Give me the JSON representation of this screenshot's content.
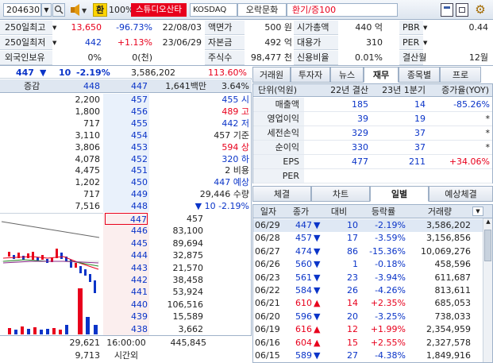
{
  "toolbar": {
    "code": "204630",
    "hwan": "환",
    "zoom": "100%",
    "broker_name": "스튜디오산타",
    "market": "KOSDAQ",
    "category": "오락문화",
    "note": "환기/증100"
  },
  "info_left": [
    {
      "label": "250일최고",
      "value": "13,650",
      "pct": "-96.73%",
      "date": "22/08/03",
      "color": "red",
      "pct_color": "blue"
    },
    {
      "label": "250일최저",
      "value": "442",
      "pct": "+1.13%",
      "date": "23/06/29",
      "color": "blue",
      "pct_color": "red"
    },
    {
      "label": "외국인보유",
      "value": "0%",
      "pct": "0(천)",
      "date": ""
    }
  ],
  "info_mid": [
    {
      "label": "액면가",
      "value": "500 원"
    },
    {
      "label": "자본금",
      "value": "492 억"
    },
    {
      "label": "주식수",
      "value": "98,477 천"
    }
  ],
  "info_right": [
    {
      "label": "시가총액",
      "value": "440 억",
      "label2": "PBR",
      "value2": "0.44"
    },
    {
      "label": "대용가",
      "value": "310",
      "label2": "PER",
      "value2": ""
    },
    {
      "label": "신용비율",
      "value": "0.01%",
      "label2": "결산월",
      "value2": "12월"
    }
  ],
  "quote": {
    "price": "447",
    "arrow": "▼",
    "change": "10",
    "pct": "-2.19%",
    "volume": "3,586,202",
    "vol_pct": "113.60%",
    "gamgam": "증감",
    "bid_price": "448",
    "ask_price": "447",
    "amount": "1,641백만",
    "ratio": "3.64%"
  },
  "ask_rows": [
    {
      "qty": "2,200",
      "price": "457",
      "label": "455 시",
      "lc": "blue"
    },
    {
      "qty": "1,800",
      "price": "456",
      "label": "489 고",
      "lc": "red"
    },
    {
      "qty": "717",
      "price": "455",
      "label": "442 저",
      "lc": "blue"
    },
    {
      "qty": "3,110",
      "price": "454",
      "label": "457 기준",
      "lc": ""
    },
    {
      "qty": "3,806",
      "price": "453",
      "label": "594 상",
      "lc": "red"
    },
    {
      "qty": "4,078",
      "price": "452",
      "label": "320 하",
      "lc": "blue"
    },
    {
      "qty": "4,475",
      "price": "451",
      "label": "2 비용",
      "lc": ""
    },
    {
      "qty": "1,202",
      "price": "450",
      "label": "447 예상",
      "lc": "blue"
    },
    {
      "qty": "717",
      "price": "449",
      "label": "29,446 수량",
      "lc": ""
    },
    {
      "qty": "7,516",
      "price": "448",
      "label": "▼ 10   -2.19%",
      "lc": "blue"
    }
  ],
  "bid_rows": [
    {
      "price": "447",
      "qty": "457"
    },
    {
      "price": "446",
      "qty": "83,100"
    },
    {
      "price": "445",
      "qty": "89,694"
    },
    {
      "price": "444",
      "qty": "32,875"
    },
    {
      "price": "443",
      "qty": "21,570"
    },
    {
      "price": "442",
      "qty": "38,458"
    },
    {
      "price": "441",
      "qty": "53,924"
    },
    {
      "price": "440",
      "qty": "106,516"
    },
    {
      "price": "439",
      "qty": "15,589"
    },
    {
      "price": "438",
      "qty": "3,662"
    }
  ],
  "totals": {
    "ask_total": "29,621",
    "ask_after": "9,713",
    "time": "16:00:00",
    "after_label": "시간외",
    "bid_total": "445,845"
  },
  "top_tabs": [
    "거래원",
    "투자자",
    "뉴스",
    "재무",
    "종목별",
    "프로"
  ],
  "fin": {
    "headers": [
      "단위(억원)",
      "22년 결산",
      "23년 1분기",
      "증가율(YOY)"
    ],
    "rows": [
      {
        "label": "매출액",
        "a": "185",
        "b": "14",
        "c": "-85.26%",
        "cc": "blue"
      },
      {
        "label": "영업이익",
        "a": "39",
        "b": "19",
        "c": "*",
        "cc": ""
      },
      {
        "label": "세전손익",
        "a": "329",
        "b": "37",
        "c": "*",
        "cc": ""
      },
      {
        "label": "순이익",
        "a": "330",
        "b": "37",
        "c": "*",
        "cc": ""
      },
      {
        "label": "EPS",
        "a": "477",
        "b": "211",
        "c": "+34.06%",
        "cc": "red"
      },
      {
        "label": "PER",
        "a": "",
        "b": "",
        "c": "",
        "cc": ""
      }
    ]
  },
  "bottom_tabs": [
    "체결",
    "차트",
    "일별",
    "예상체결"
  ],
  "daily": {
    "headers": [
      "일자",
      "종가",
      "대비",
      "등락률",
      "거래량"
    ],
    "rows": [
      {
        "date": "06/29",
        "close": "447",
        "arrow": "▼",
        "diff": "10",
        "pct": "-2.19%",
        "vol": "3,586,202",
        "dir": "down"
      },
      {
        "date": "06/28",
        "close": "457",
        "arrow": "▼",
        "diff": "17",
        "pct": "-3.59%",
        "vol": "3,156,856",
        "dir": "down"
      },
      {
        "date": "06/27",
        "close": "474",
        "arrow": "▼",
        "diff": "86",
        "pct": "-15.36%",
        "vol": "10,069,276",
        "dir": "down"
      },
      {
        "date": "06/26",
        "close": "560",
        "arrow": "▼",
        "diff": "1",
        "pct": "-0.18%",
        "vol": "458,596",
        "dir": "down"
      },
      {
        "date": "06/23",
        "close": "561",
        "arrow": "▼",
        "diff": "23",
        "pct": "-3.94%",
        "vol": "611,687",
        "dir": "down"
      },
      {
        "date": "06/22",
        "close": "584",
        "arrow": "▼",
        "diff": "26",
        "pct": "-4.26%",
        "vol": "813,611",
        "dir": "down"
      },
      {
        "date": "06/21",
        "close": "610",
        "arrow": "▲",
        "diff": "14",
        "pct": "+2.35%",
        "vol": "685,053",
        "dir": "up"
      },
      {
        "date": "06/20",
        "close": "596",
        "arrow": "▼",
        "diff": "20",
        "pct": "-3.25%",
        "vol": "738,033",
        "dir": "down"
      },
      {
        "date": "06/19",
        "close": "616",
        "arrow": "▲",
        "diff": "12",
        "pct": "+1.99%",
        "vol": "2,354,959",
        "dir": "up"
      },
      {
        "date": "06/16",
        "close": "604",
        "arrow": "▲",
        "diff": "15",
        "pct": "+2.55%",
        "vol": "2,327,578",
        "dir": "up"
      },
      {
        "date": "06/15",
        "close": "589",
        "arrow": "▼",
        "diff": "27",
        "pct": "-4.38%",
        "vol": "1,849,916",
        "dir": "down"
      }
    ]
  },
  "colors": {
    "up": "#e8001c",
    "down": "#0a34c8",
    "ask_bg": "#e9f1fb",
    "bid_bg": "#fbeeee",
    "header": "#dfe7f1"
  }
}
